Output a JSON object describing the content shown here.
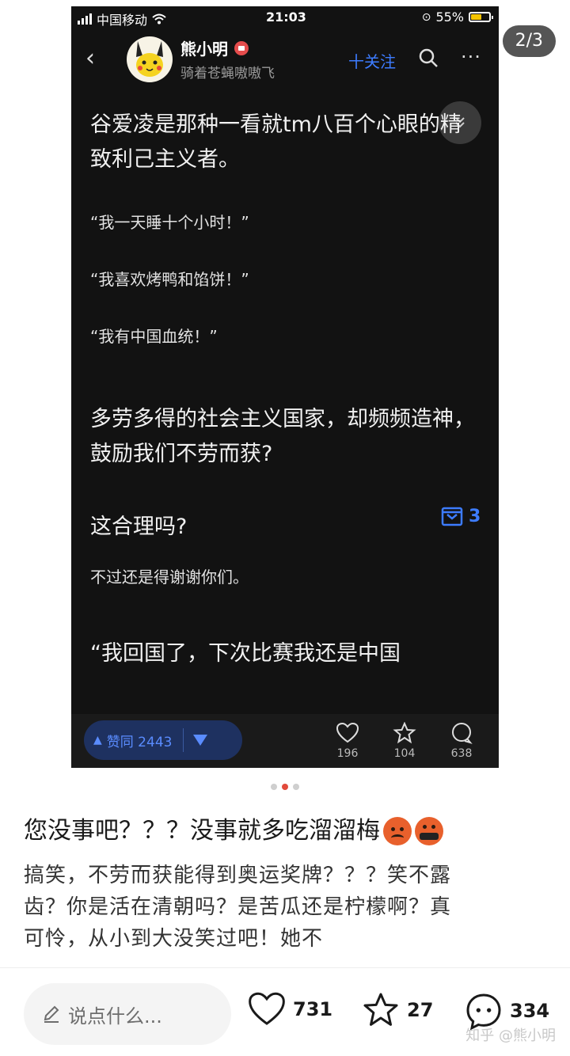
{
  "page_counter": "2/3",
  "screenshot": {
    "status": {
      "carrier": "中国移动",
      "time": "21:03",
      "battery": "55%"
    },
    "nav": {
      "author_name": "熊小明",
      "author_sub": "骑着苍蝇嗷嗷飞",
      "follow_label": "十关注"
    },
    "paragraphs": [
      "谷爱凌是那种一看就tm八百个心眼的精致利己主义者。",
      "“我一天睡十个小时！”",
      "“我喜欢烤鸭和馅饼！”",
      "“我有中国血统！”",
      "多劳多得的社会主义国家，却频频造神，鼓励我们不劳而获?",
      "这合理吗?",
      "不过还是得谢谢你们。",
      "“我回国了，下次比赛我还是中国"
    ],
    "fav_count": "3",
    "vote_label": "赞同 2443",
    "likes": "196",
    "favorites": "104",
    "comments": "638"
  },
  "post": {
    "title": "您没事吧？？？没事就多吃溜溜梅",
    "body": "搞笑，不劳而获能得到奥运奖牌？？？笑不露齿？你是活在清朝吗？是苦瓜还是柠檬啊？真可怜，从小到大没笑过吧！她不"
  },
  "footer": {
    "comment_placeholder": "说点什么...",
    "likes": "731",
    "favorites": "27",
    "comments": "334",
    "watermark": "知乎 @熊小明"
  },
  "colors": {
    "accent_blue": "#3d7cff",
    "active_dot": "#e24a3b",
    "dark_bg": "#121212"
  }
}
